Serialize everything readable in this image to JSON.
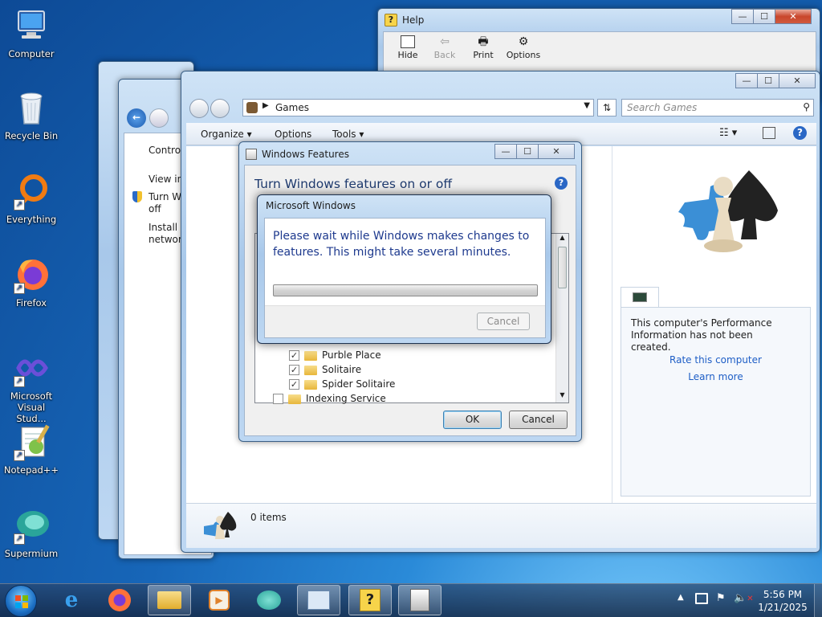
{
  "desktop": {
    "icons": [
      {
        "label": "Computer"
      },
      {
        "label": "Recycle Bin"
      },
      {
        "label": "Everything"
      },
      {
        "label": "Firefox"
      },
      {
        "label": "Microsoft Visual Stud..."
      },
      {
        "label": "Notepad++"
      },
      {
        "label": "Supermium"
      }
    ]
  },
  "help_window": {
    "title": "Help",
    "toolbar": {
      "hide": "Hide",
      "back": "Back",
      "print": "Print",
      "options": "Options"
    }
  },
  "control_panel": {
    "items": {
      "control": "Control",
      "view": "View ins",
      "turn": "Turn W",
      "turn2": "off",
      "install": "Install a",
      "network": "network"
    }
  },
  "games_window": {
    "breadcrumb": "Games",
    "search_placeholder": "Search Games",
    "menu": {
      "organize": "Organize",
      "options": "Options",
      "tools": "Tools"
    },
    "perf_text": "This computer's Performance Information has not been created.",
    "rate_link": "Rate this computer",
    "learn_link": "Learn more",
    "status": "0 items"
  },
  "features_dialog": {
    "title": "Windows Features",
    "heading": "Turn Windows features on or off",
    "tree": [
      {
        "label": "Purble Place",
        "checked": true
      },
      {
        "label": "Solitaire",
        "checked": true
      },
      {
        "label": "Spider Solitaire",
        "checked": true
      },
      {
        "label": "Indexing Service",
        "checked": false
      }
    ],
    "ok": "OK",
    "cancel": "Cancel"
  },
  "progress_dialog": {
    "title": "Microsoft Windows",
    "message": "Please wait while Windows makes changes to features. This might take several minutes.",
    "progress": 0,
    "cancel": "Cancel"
  },
  "taskbar": {
    "time": "5:56 PM",
    "date": "1/21/2025"
  }
}
